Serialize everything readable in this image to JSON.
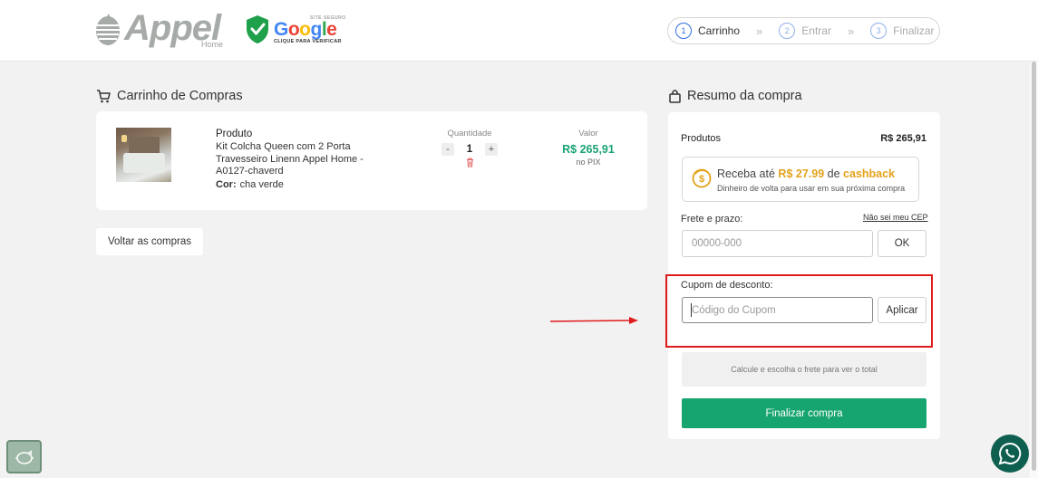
{
  "header": {
    "logo_text": "Appel",
    "logo_sub": "Home",
    "google_badge": {
      "small": "SITE SEGURO",
      "word_letters": [
        {
          "ch": "G",
          "color": "#4285f4"
        },
        {
          "ch": "o",
          "color": "#ea4335"
        },
        {
          "ch": "o",
          "color": "#fbbc05"
        },
        {
          "ch": "g",
          "color": "#4285f4"
        },
        {
          "ch": "l",
          "color": "#34a853"
        },
        {
          "ch": "e",
          "color": "#ea4335"
        }
      ],
      "cta": "CLIQUE PARA VERIFICAR"
    },
    "steps": [
      {
        "num": "1",
        "label": "Carrinho"
      },
      {
        "num": "2",
        "label": "Entrar"
      },
      {
        "num": "3",
        "label": "Finalizar"
      }
    ],
    "step_sep": "»"
  },
  "cart": {
    "title": "Carrinho de Compras",
    "product_header": "Produto",
    "product_name": "Kit Colcha Queen com 2 Porta Travesseiro Linenn Appel Home - A0127-chaverd",
    "attr_label": "Cor:",
    "attr_value": "cha verde",
    "quantity_label": "Quantidade",
    "quantity_minus": "-",
    "quantity_value": "1",
    "quantity_plus": "+",
    "price_label": "Valor",
    "price_value": "R$ 265,91",
    "price_sub": "no PIX",
    "back_button": "Voltar as compras"
  },
  "summary": {
    "title": "Resumo da compra",
    "products_label": "Produtos",
    "products_value": "R$ 265,91",
    "cashback": {
      "prefix": "Receba até",
      "amount": "R$ 27.99",
      "middle": "de",
      "keyword": "cashback",
      "subtitle": "Dinheiro de volta para usar em sua próxima compra"
    },
    "shipping_label": "Frete e prazo:",
    "cep_link": "Não sei meu CEP",
    "cep_placeholder": "00000-000",
    "ok_button": "OK",
    "coupon_label": "Cupom de desconto:",
    "coupon_placeholder": "Código do Cupom",
    "apply_button": "Aplicar",
    "total_note": "Calcule e escolha o frete para ver o total",
    "finish_button": "Finalizar compra"
  },
  "colors": {
    "accent_green": "#16a46f",
    "price_green": "#1aa373",
    "cashback_gold": "#e3a21a",
    "highlight_red": "#e01b1b",
    "step_blue": "#2f6fe0"
  },
  "icons": [
    "appel-logo-icon",
    "google-shield-icon",
    "cart-icon",
    "bag-icon",
    "trash-icon",
    "cashback-coin-icon",
    "cookie-icon",
    "whatsapp-icon",
    "red-arrow-annotation"
  ]
}
